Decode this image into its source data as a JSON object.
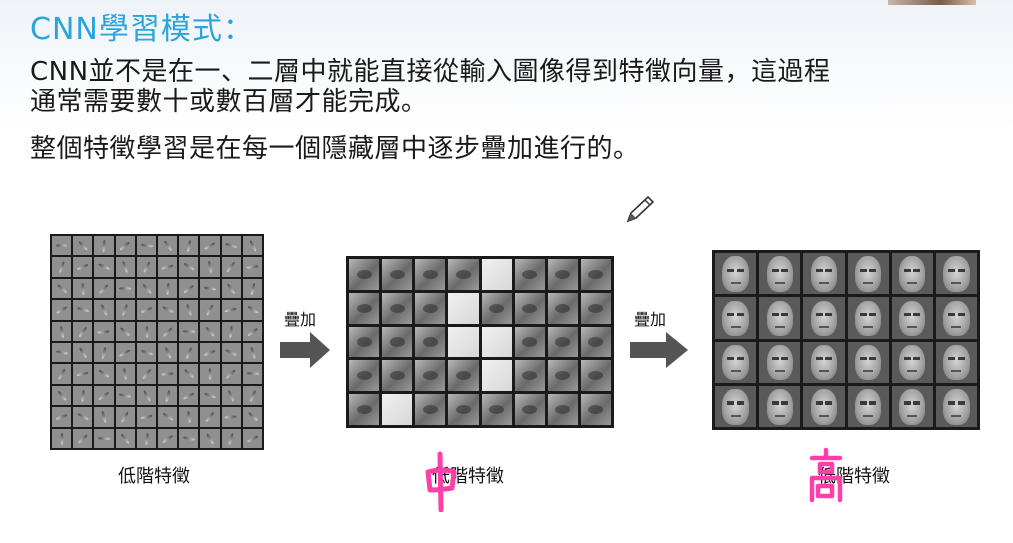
{
  "slide": {
    "title": "CNN學習模式：",
    "line1": "CNN並不是在一、二層中就能直接從輸入圖像得到特徵向量，這過程",
    "line2": "通常需要數十或數百層才能完成。",
    "line3": "整個特徵學習是在每一個隱藏層中逐步疊加進行的。"
  },
  "figure": {
    "arrow1_label": "疊加",
    "arrow2_label": "疊加",
    "caption1": "低階特徵",
    "caption2": "低階特徵",
    "caption3": "低階特徵"
  },
  "annotations": {
    "handwritten1": "中",
    "handwritten2": "高",
    "color": "#ff3fa8"
  },
  "colors": {
    "title": "#2aa4dc",
    "arrow": "#555555"
  }
}
